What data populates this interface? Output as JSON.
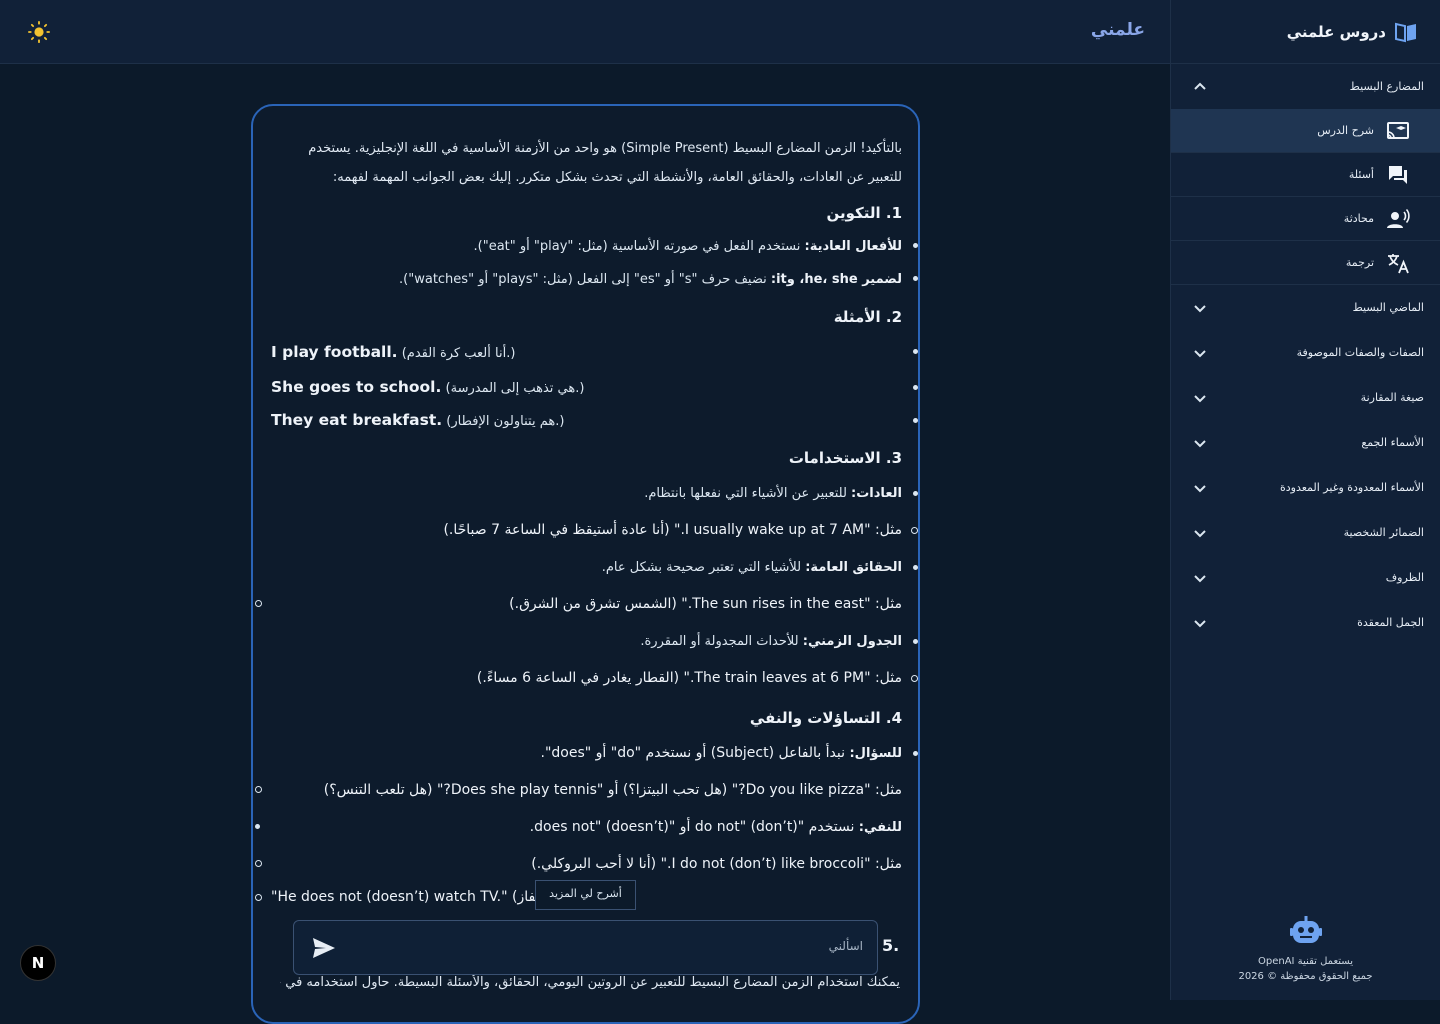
{
  "topbar": {
    "brand": "علمني",
    "theme_icon": "sun-icon"
  },
  "sidebar": {
    "title": "دروس علمني",
    "sections": [
      {
        "label": "المضارع البسيط",
        "expanded": true
      },
      {
        "label": "الماضي البسيط"
      },
      {
        "label": "الصفات والصفات الموصوفة"
      },
      {
        "label": "صيغة المقارنة"
      },
      {
        "label": "الأسماء الجمع"
      },
      {
        "label": "الأسماء المعدودة وغير المعدودة"
      },
      {
        "label": "الضمائر الشخصية"
      },
      {
        "label": "الظروف"
      },
      {
        "label": "الجمل المعقدة"
      }
    ],
    "subitems": [
      {
        "label": "شرح الدرس",
        "icon": "cast-for-education-icon"
      },
      {
        "label": "أسئلة",
        "icon": "chat-bubbles-icon"
      },
      {
        "label": "محادثة",
        "icon": "voice-person-icon"
      },
      {
        "label": "ترجمة",
        "icon": "translate-icon"
      }
    ],
    "footer": {
      "powered": "يستعمل تقنية OpenAI",
      "rights": "جميع الحقوق محفوظة © 2026"
    }
  },
  "message": {
    "intro": "بالتأكيد! الزمن المضارع البسيط (Simple Present) هو واحد من الأزمنة الأساسية في اللغة الإنجليزية. يستخدم للتعبير عن العادات، والحقائق العامة، والأنشطة التي تحدث بشكل متكرر. إليك بعض الجوانب المهمة لفهمه:",
    "h1": "1. التكوين",
    "f1_b": "للأفعال العادية:",
    "f1_t": " نستخدم الفعل في صورته الأساسية (مثل: \"play\" أو \"eat\").",
    "f2_b": "لضمير he، she، وit:",
    "f2_t": " نضيف حرف \"s\" أو \"es\" إلى الفعل (مثل: \"plays\" أو \"watches\").",
    "h2": "2. الأمثلة",
    "ex1_en": "I play football.",
    "ex1_ar": "(أنا ألعب كرة القدم.)",
    "ex2_en": "She goes to school.",
    "ex2_ar": "(هي تذهب إلى المدرسة.)",
    "ex3_en": "They eat breakfast.",
    "ex3_ar": "(هم يتناولون الإفطار.)",
    "h3": "3. الاستخدامات",
    "u1_b": "العادات:",
    "u1_t": " للتعبير عن الأشياء التي نفعلها بانتظام.",
    "u1_ex": "مثل: \"I usually wake up at 7 AM.\" (أنا عادة أستيقظ في الساعة 7 صباحًا.)",
    "u2_b": "الحقائق العامة:",
    "u2_t": " للأشياء التي تعتبر صحيحة بشكل عام.",
    "u2_ex": "مثل: \"The sun rises in the east.\" (الشمس تشرق من الشرق.)",
    "u3_b": "الجدول الزمني:",
    "u3_t": " للأحداث المجدولة أو المقررة.",
    "u3_ex": "مثل: \"The train leaves at 6 PM.\" (القطار يغادر في الساعة 6 مساءً.)",
    "h4": "4. التساؤلات والنفي",
    "q_b": "للسؤال:",
    "q_t": " نبدأ بالفاعل (Subject) أو نستخدم \"do\" أو \"does\".",
    "q_ex": "مثل: \"Do you like pizza?\" (هل تحب البيتزا؟) أو \"Does she play tennis?\" (هل تلعب التنس؟)",
    "n_b": "للنفي:",
    "n_t": " نستخدم \"do not\" (don’t) أو \"does not\" (doesn’t).",
    "n_ex": "مثل: \"I do not (don’t) like broccoli.\" (أنا لا أحب البروكلي.)",
    "n_ex2": "\"He does not (doesn’t) watch TV.\" (هو لا يشاهد التلفاز.)",
    "h5": "5.",
    "last_line": "يمكنك استخدام الزمن المضارع البسيط للتعبير عن الروتين اليومي، الحقائق، والأسئلة البسيطة. حاول استخدامه في جمل"
  },
  "tooltip": "أشرح لي المزيد",
  "input": {
    "placeholder": "اسألني"
  },
  "nbadge": "N"
}
